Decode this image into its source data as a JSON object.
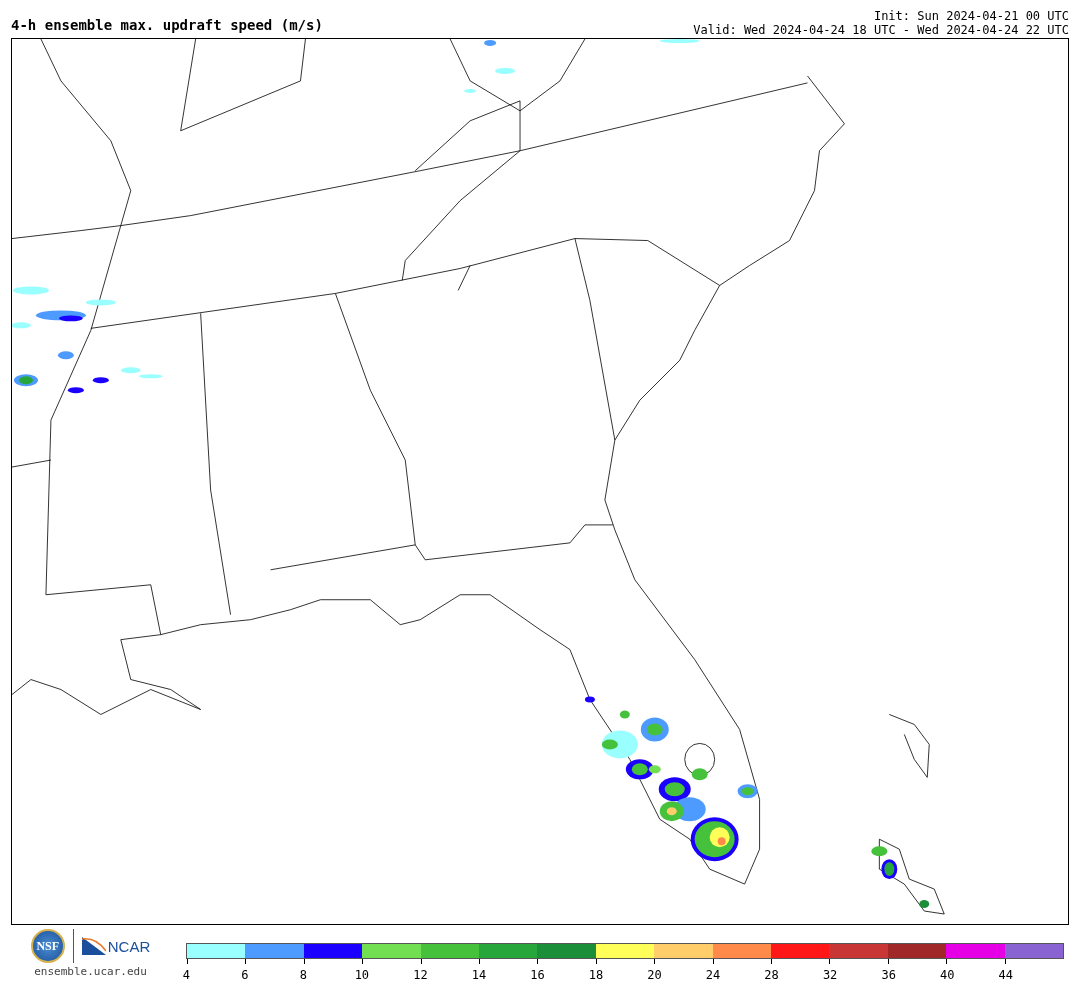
{
  "header": {
    "title": "4-h ensemble max. updraft speed (m/s)",
    "init": "Init: Sun 2024-04-21 00 UTC",
    "valid": "Valid: Wed 2024-04-24 18 UTC - Wed 2024-04-24 22 UTC"
  },
  "footer": {
    "nsf_logo": "NSF",
    "ncar_logo": "NCAR",
    "url": "ensemble.ucar.edu"
  },
  "colorbar": [
    {
      "color": "#99ffff",
      "label": "4"
    },
    {
      "color": "#4e9bff",
      "label": "6"
    },
    {
      "color": "#1b00ff",
      "label": "8"
    },
    {
      "color": "#72df52",
      "label": "10"
    },
    {
      "color": "#45c13b",
      "label": "12"
    },
    {
      "color": "#27a73b",
      "label": "14"
    },
    {
      "color": "#1b8e39",
      "label": "16"
    },
    {
      "color": "#ffff5a",
      "label": "18"
    },
    {
      "color": "#ffce6b",
      "label": "20"
    },
    {
      "color": "#ff8a4a",
      "label": "24"
    },
    {
      "color": "#ff1616",
      "label": "28"
    },
    {
      "color": "#c93636",
      "label": "32"
    },
    {
      "color": "#a12828",
      "label": "36"
    },
    {
      "color": "#e600e6",
      "label": "40"
    },
    {
      "color": "#8a63d2",
      "label": "44"
    }
  ]
}
